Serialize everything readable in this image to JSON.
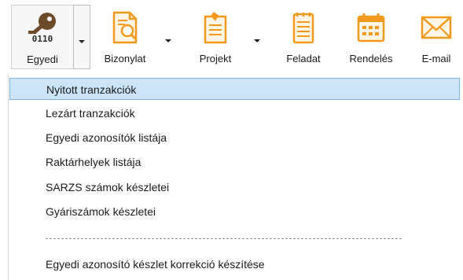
{
  "toolbar": {
    "buttons": [
      {
        "label": "Egyedi",
        "icon_text": "0110",
        "icon": "key-icon"
      },
      {
        "label": "Bizonylat",
        "icon": "document-search-icon"
      },
      {
        "label": "Projekt",
        "icon": "clipboard-pin-icon"
      },
      {
        "label": "Feladat",
        "icon": "notepad-icon"
      },
      {
        "label": "Rendelés",
        "icon": "calendar-icon"
      },
      {
        "label": "E-mail",
        "icon": "envelope-icon"
      }
    ]
  },
  "menu": {
    "items": [
      {
        "label": "Nyitott tranzakciók"
      },
      {
        "label": "Lezárt tranzakciók"
      },
      {
        "label": "Egyedi azonosítók listája"
      },
      {
        "label": "Raktárhelyek listája"
      },
      {
        "label": "SARZS számok készletei"
      },
      {
        "label": "Gyáriszámok készletei"
      },
      {
        "label": "Egyedi azonosító készlet korrekció készítése"
      }
    ]
  },
  "colors": {
    "orange": "#f39a1e",
    "key_brown": "#6d4a2a",
    "selection_fill": "#cce4f7",
    "selection_border": "#7eb4ea"
  }
}
